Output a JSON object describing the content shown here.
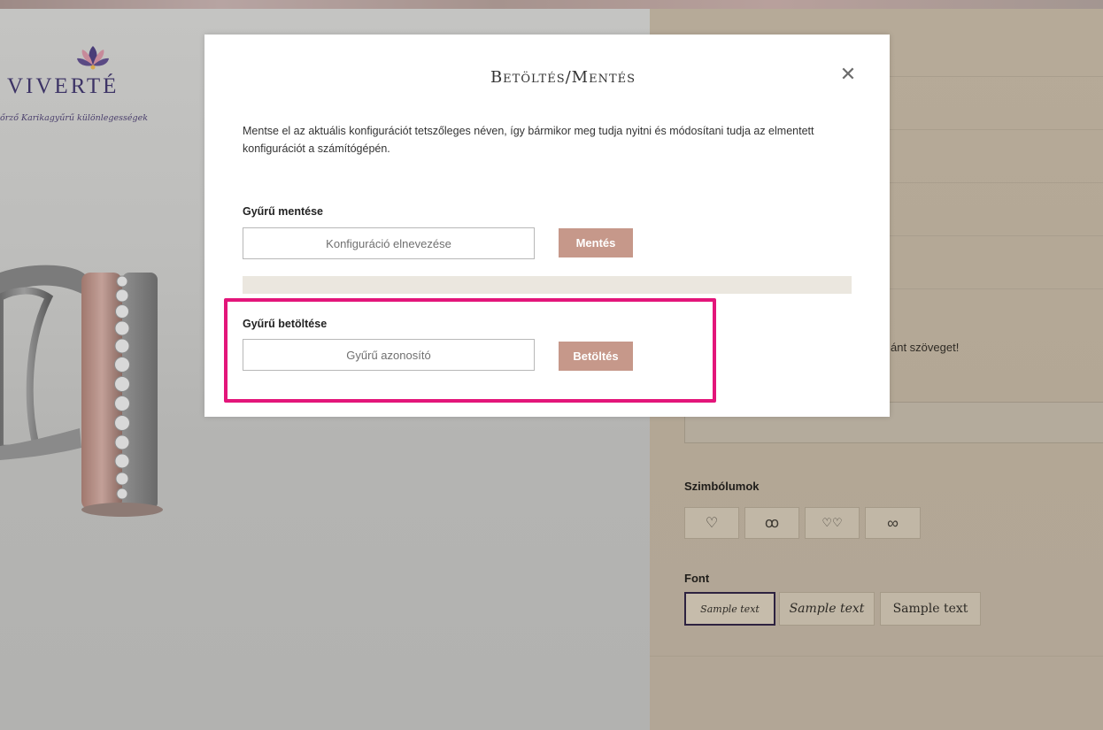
{
  "brand": {
    "name": "VIVERTÉ",
    "tagline": "őrző Karikagyűrű különlegességek"
  },
  "modal": {
    "title": "Betöltés/Mentés",
    "close_icon": "close-icon",
    "description": "Mentse el az aktuális konfigurációt tetszőleges néven, így bármikor meg tudja nyitni és módosítani tudja az elmentett konfigurációt a számítógépén.",
    "save_section": {
      "label": "Gyűrű mentése",
      "input_placeholder": "Konfiguráció elnevezése",
      "input_value": "",
      "button_label": "Mentés"
    },
    "load_section": {
      "label": "Gyűrű betöltése",
      "input_placeholder": "Gyűrű azonosító",
      "input_value": "",
      "button_label": "Betöltés"
    }
  },
  "right_panel": {
    "visible_text_fragment": "ánt szöveget!",
    "symbols_label": "Szimbólumok",
    "symbols": [
      "heart-symbol",
      "rings-symbol",
      "double-heart-symbol",
      "infinity-symbol"
    ],
    "symbol_glyphs": [
      "♡",
      "ꝏ",
      "♡♡",
      "∞"
    ],
    "font_label": "Font",
    "font_options": [
      "Sample text",
      "Sample text",
      "Sample text"
    ]
  },
  "colors": {
    "accent_button": "#c6988a",
    "highlight": "#e3157a",
    "brand": "#3d3466"
  }
}
